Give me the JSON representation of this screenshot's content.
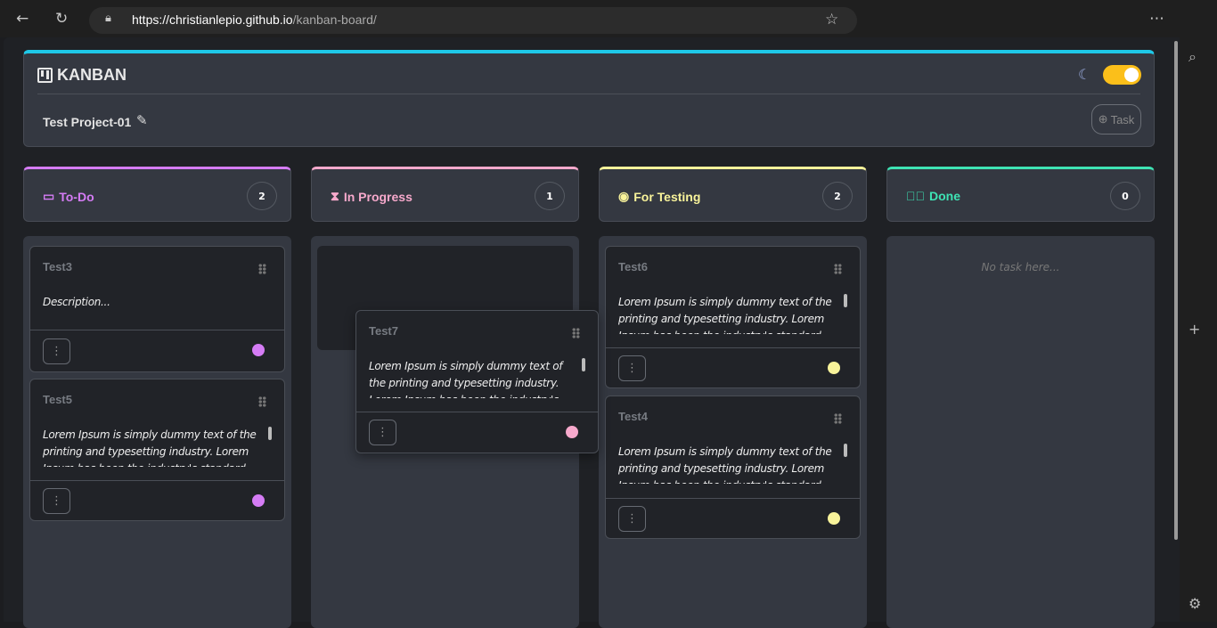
{
  "browser": {
    "url_host": "https://christianlepio.github.io",
    "url_path": "/kanban-board/"
  },
  "header": {
    "title": "KANBAN",
    "project": "Test Project-01",
    "add_task_label": "Task",
    "theme_toggle_on": true,
    "accent": "#1ec8e8"
  },
  "columns": [
    {
      "title": "To-Do",
      "count": "2",
      "color": "#d57cf5",
      "empty": ""
    },
    {
      "title": "In Progress",
      "count": "1",
      "color": "#f7a9cc",
      "empty": ""
    },
    {
      "title": "For Testing",
      "count": "2",
      "color": "#f8f39a",
      "empty": ""
    },
    {
      "title": "Done",
      "count": "0",
      "color": "#3ee3b4",
      "empty": "No task here..."
    }
  ],
  "cards": {
    "test3": {
      "title": "Test3",
      "desc": "Description..."
    },
    "test5": {
      "title": "Test5",
      "desc": "Lorem Ipsum is simply dummy text of the printing and typesetting industry. Lorem Ipsum has been the industry's standard"
    },
    "test7": {
      "title": "Test7",
      "desc": "Lorem Ipsum is simply dummy text of the printing and typesetting industry. Lorem Ipsum has been the industry's standard"
    },
    "test6": {
      "title": "Test6",
      "desc": "Lorem Ipsum is simply dummy text of the printing and typesetting industry. Lorem Ipsum has been the industry's standard"
    },
    "test4": {
      "title": "Test4",
      "desc": "Lorem Ipsum is simply dummy text of the printing and typesetting industry. Lorem Ipsum has been the industry's standard"
    }
  }
}
